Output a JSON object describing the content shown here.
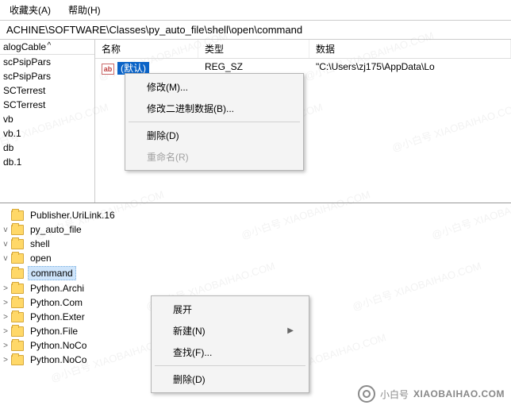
{
  "menubar": {
    "favorites": "收藏夹(A)",
    "help": "帮助(H)"
  },
  "address": "ACHINE\\SOFTWARE\\Classes\\py_auto_file\\shell\\open\\command",
  "left_tree": {
    "header": "alogCable",
    "items": [
      "scPsipPars",
      "scPsipPars",
      "SCTerrest",
      "SCTerrest",
      "vb",
      "vb.1",
      "db",
      "db.1"
    ]
  },
  "list": {
    "headers": {
      "name": "名称",
      "type": "类型",
      "data": "数据"
    },
    "row": {
      "icon": "ab",
      "name": "(默认)",
      "type": "REG_SZ",
      "data": "\"C:\\Users\\zj175\\AppData\\Lo"
    }
  },
  "context1": {
    "modify": "修改(M)...",
    "modify_binary": "修改二进制数据(B)...",
    "delete": "删除(D)",
    "rename": "重命名(R)"
  },
  "folder_tree": {
    "items": [
      {
        "ind": 1,
        "tw": "",
        "label": "Publisher.UriLink.16"
      },
      {
        "ind": 1,
        "tw": "v",
        "label": "py_auto_file"
      },
      {
        "ind": 2,
        "tw": "v",
        "label": "shell"
      },
      {
        "ind": 3,
        "tw": "v",
        "label": "open"
      },
      {
        "ind": 4,
        "tw": "",
        "label": "command",
        "sel": true
      },
      {
        "ind": 1,
        "tw": ">",
        "label": "Python.Archi"
      },
      {
        "ind": 1,
        "tw": ">",
        "label": "Python.Com"
      },
      {
        "ind": 1,
        "tw": ">",
        "label": "Python.Exter"
      },
      {
        "ind": 1,
        "tw": ">",
        "label": "Python.File"
      },
      {
        "ind": 1,
        "tw": ">",
        "label": "Python.NoCo"
      },
      {
        "ind": 1,
        "tw": ">",
        "label": "Python.NoCo"
      }
    ]
  },
  "context2": {
    "expand": "展开",
    "new": "新建(N)",
    "find": "查找(F)...",
    "delete": "删除(D)"
  },
  "watermark": {
    "cn": "小白号",
    "en": "XIAOBAIHAO.COM",
    "bg": "@小白号 XIAOBAIHAO.COM"
  }
}
